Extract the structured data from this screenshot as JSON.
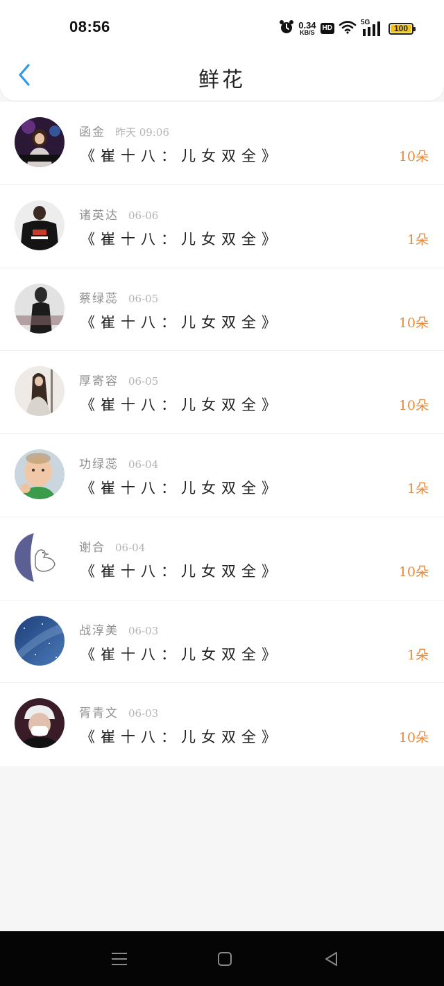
{
  "status_bar": {
    "time": "08:56",
    "net_speed_value": "0.34",
    "net_speed_unit": "KB/S",
    "hd_label": "HD",
    "network_type": "5G",
    "battery_level": "100"
  },
  "header": {
    "title": "鲜花"
  },
  "colors": {
    "accent_back": "#2e9ae6",
    "count_orange": "#e58a3e",
    "battery_fill": "#f0c419"
  },
  "gifts": [
    {
      "name": "函金",
      "date": "昨天 09:06",
      "work": "《崔十八：儿女双全》",
      "count": "10朵",
      "avatar_icon": "dj-girl-avatar"
    },
    {
      "name": "诸英达",
      "date": "06-06",
      "work": "《崔十八：儿女双全》",
      "count": "1朵",
      "avatar_icon": "jacket-person-avatar"
    },
    {
      "name": "蔡绿蕊",
      "date": "06-05",
      "work": "《崔十八：儿女双全》",
      "count": "10朵",
      "avatar_icon": "bw-girl-avatar"
    },
    {
      "name": "厚寄容",
      "date": "06-05",
      "work": "《崔十八：儿女双全》",
      "count": "10朵",
      "avatar_icon": "long-hair-girl-avatar"
    },
    {
      "name": "功绿蕊",
      "date": "06-04",
      "work": "《崔十八：儿女双全》",
      "count": "1朵",
      "avatar_icon": "baby-fist-avatar"
    },
    {
      "name": "谢合",
      "date": "06-04",
      "work": "《崔十八：儿女双全》",
      "count": "10朵",
      "avatar_icon": "duck-drawing-avatar"
    },
    {
      "name": "战淳美",
      "date": "06-03",
      "work": "《崔十八：儿女双全》",
      "count": "1朵",
      "avatar_icon": "starry-sky-avatar"
    },
    {
      "name": "胥青文",
      "date": "06-03",
      "work": "《崔十八：儿女双全》",
      "count": "10朵",
      "avatar_icon": "masked-boy-avatar"
    }
  ],
  "nav_bar": {
    "menu_icon": "menu-icon",
    "home_icon": "home-square-icon",
    "back_icon": "back-triangle-icon"
  }
}
